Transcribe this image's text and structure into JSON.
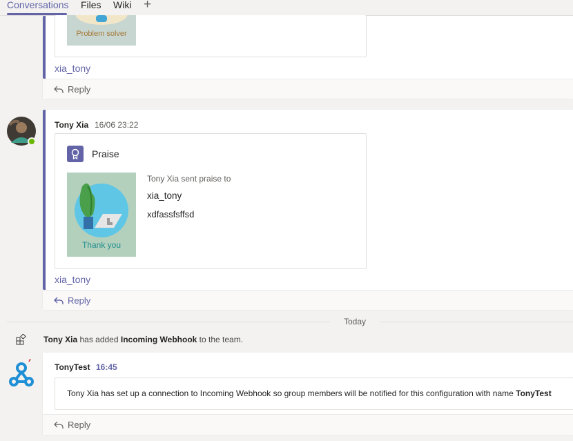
{
  "tabs": {
    "items": [
      "Conversations",
      "Files",
      "Wiki"
    ],
    "add_label": "+"
  },
  "thread1": {
    "card_caption": "Problem solver",
    "mention": "xia_tony",
    "reply_label": "Reply"
  },
  "thread2": {
    "author": "Tony Xia",
    "timestamp": "16/06 23:22",
    "card_title": "Praise",
    "image_caption": "Thank you",
    "sent_text": "Tony Xia sent praise to",
    "recipient": "xia_tony",
    "message": "xdfassfsffsd",
    "mention": "xia_tony",
    "reply_label": "Reply"
  },
  "date_divider": "Today",
  "system_message": {
    "actor": "Tony Xia",
    "text1": "has added",
    "target": "Incoming Webhook",
    "text2": "to the team."
  },
  "thread3": {
    "author": "TonyTest",
    "timestamp": "16:45",
    "body_prefix": "Tony Xia has set up a connection to Incoming Webhook so group members will be notified for this configuration with name",
    "body_name": "TonyTest",
    "reply_label": "Reply"
  },
  "colors": {
    "accent": "#6264a7",
    "presence": "#6bb700"
  }
}
